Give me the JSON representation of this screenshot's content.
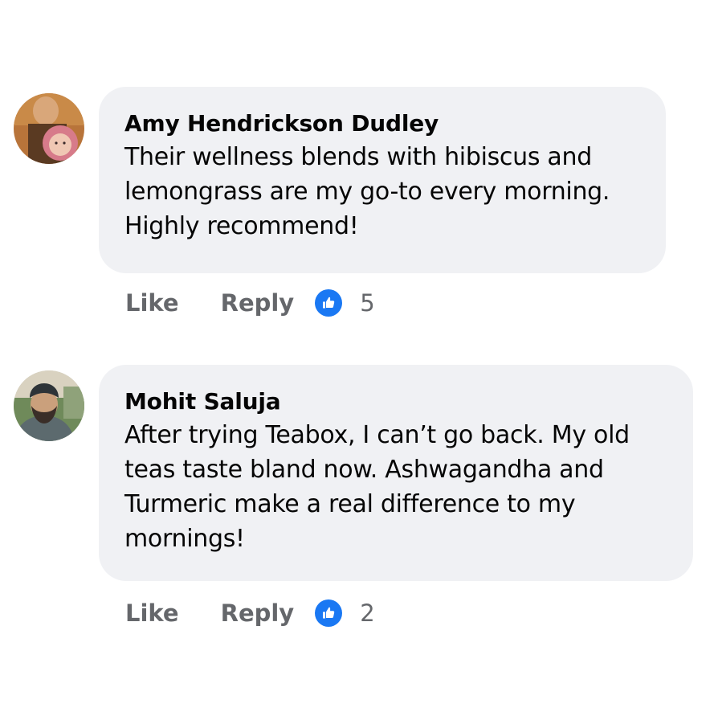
{
  "comments": [
    {
      "author": "Amy Hendrickson Dudley",
      "text": "Their wellness blends with hibiscus and lemongrass are my go-to every morning. Highly recommend!",
      "like_label": "Like",
      "reply_label": "Reply",
      "reaction_icon": "thumbs-up-icon",
      "reaction_count": "5"
    },
    {
      "author": "Mohit Saluja",
      "text": "After trying Teabox, I can’t go back. My old teas taste bland now. Ashwagandha and Turmeric make a real difference to my mornings!",
      "like_label": "Like",
      "reply_label": "Reply",
      "reaction_icon": "thumbs-up-icon",
      "reaction_count": "2"
    }
  ],
  "colors": {
    "bubble": "#f0f1f4",
    "secondary_text": "#65676b",
    "like_blue": "#1a78f3"
  }
}
